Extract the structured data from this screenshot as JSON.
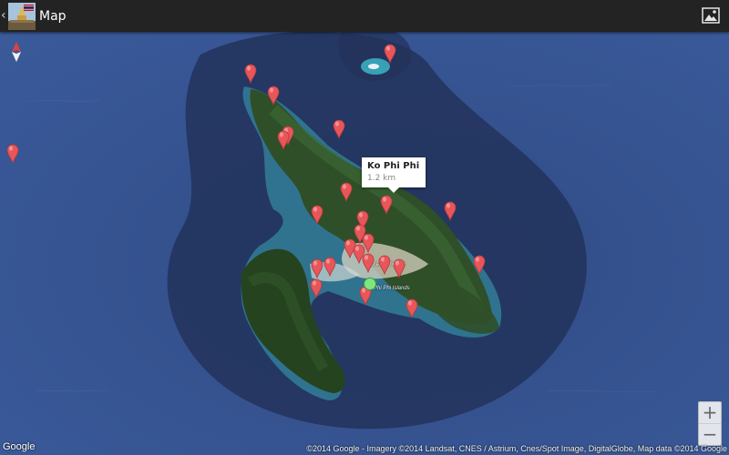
{
  "actionbar": {
    "title": "Map",
    "up_glyph": "‹"
  },
  "infowindow": {
    "title": "Ko Phi Phi",
    "distance": "1.2 km"
  },
  "map_labels": [
    "Ko Phi Phi Don",
    "Phi Phi Islands"
  ],
  "zoom": {
    "in": "+",
    "out": "−"
  },
  "google_logo": "Google",
  "attribution": "©2014 Google - Imagery ©2014 Landsat, CNES / Astrium, Cnes/Spot Image, DigitalGlobe, Map data ©2014 Google",
  "colors": {
    "pin": "#e8565a",
    "location_dot": "#7fe67f",
    "actionbar": "#232323"
  },
  "icons": [
    "back-chevron-icon",
    "app-icon",
    "layers-icon",
    "compass-icon",
    "map-pin-icon"
  ]
}
